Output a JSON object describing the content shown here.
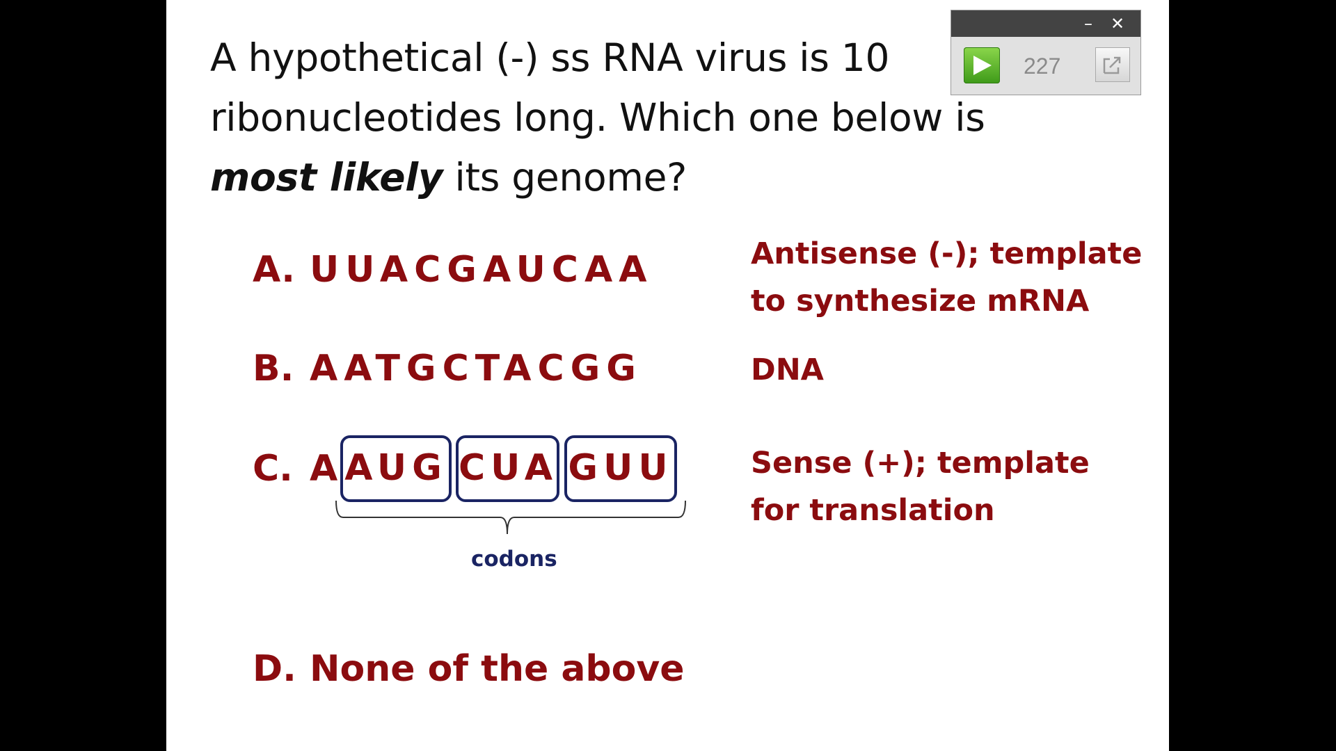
{
  "question": {
    "line1": "A hypothetical (-) ss RNA virus is 10",
    "line2": "ribonucleotides long.  Which one below is",
    "emphasis": "most likely",
    "line3_rest": " its genome?"
  },
  "options": {
    "a": {
      "letter": "A.",
      "sequence": "UUACGAUCAA"
    },
    "b": {
      "letter": "B.",
      "sequence": "AATGCTACGG"
    },
    "c": {
      "letter": "C.",
      "first": "A",
      "codons": [
        "AUG",
        "CUA",
        "GUU"
      ]
    },
    "d": {
      "letter": "D.",
      "text": "None of the above"
    }
  },
  "codons_label": "codons",
  "explanations": {
    "a_line1": "Antisense (-); template",
    "a_line2": "to synthesize mRNA",
    "b": "DNA",
    "c_line1": "Sense (+); template",
    "c_line2": "for translation"
  },
  "widget": {
    "minimize_glyph": "–",
    "close_glyph": "✕",
    "counter": "227",
    "play_icon": "play-icon",
    "expand_icon": "expand-icon"
  },
  "colors": {
    "answer_red": "#8b0c0f",
    "codon_blue": "#1a2463"
  }
}
